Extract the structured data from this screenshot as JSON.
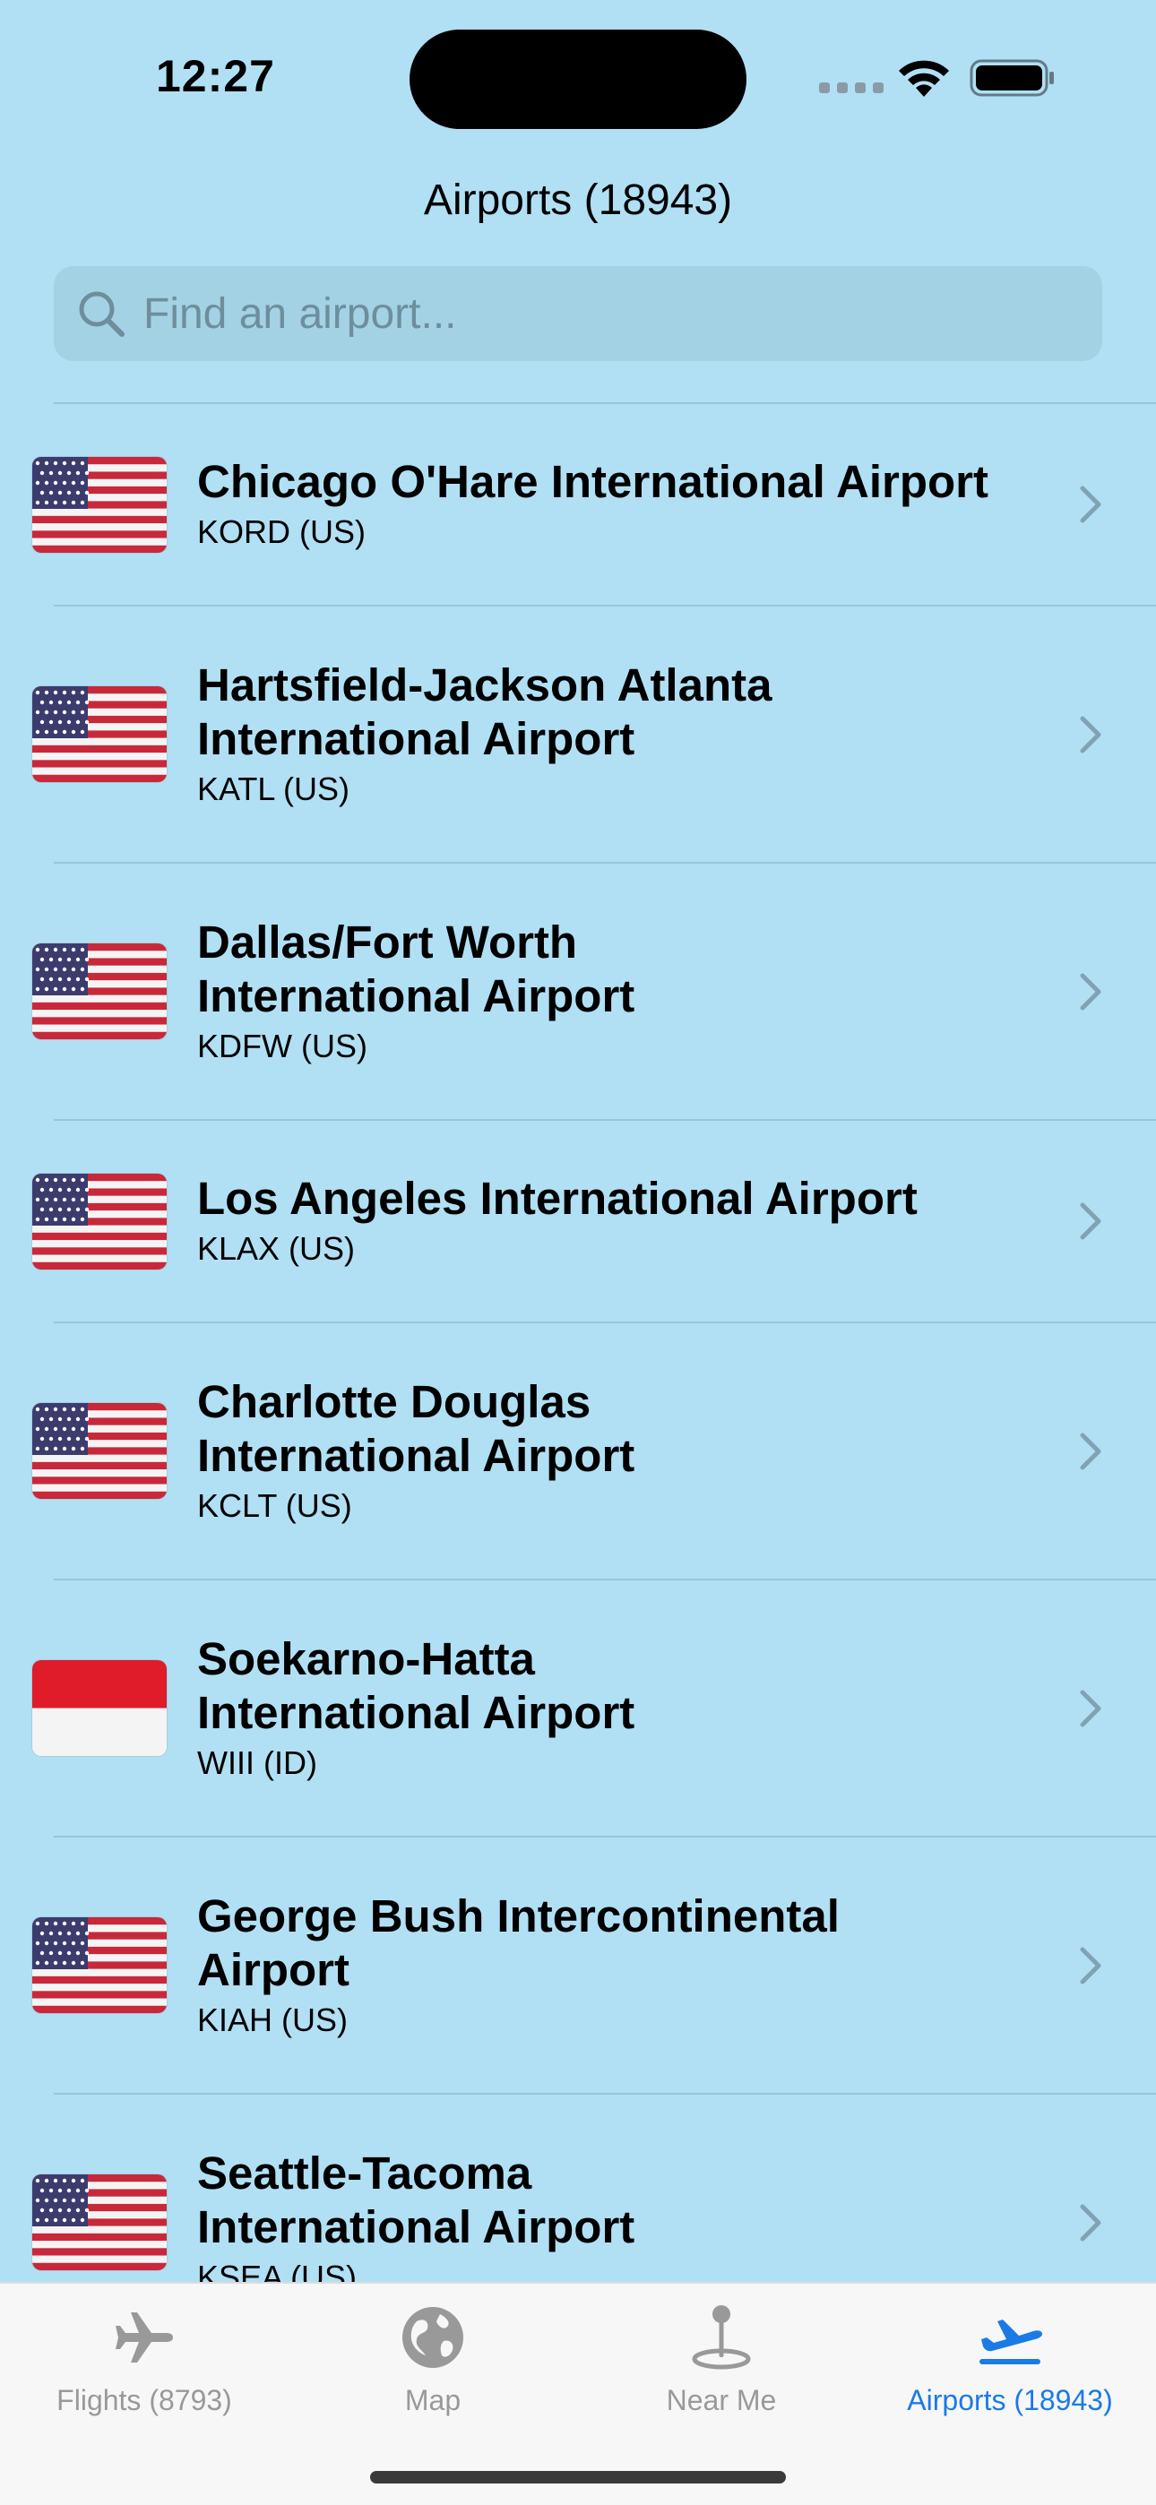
{
  "status_bar": {
    "time": "12:27"
  },
  "header": {
    "title": "Airports (18943)"
  },
  "search": {
    "placeholder": "Find an airport...",
    "icon": "search-icon"
  },
  "airports": [
    {
      "name": "Chicago O'Hare International Airport",
      "code": "KORD (US)",
      "flag": "US"
    },
    {
      "name": "Hartsfield-Jackson Atlanta International Airport",
      "code": "KATL (US)",
      "flag": "US"
    },
    {
      "name": "Dallas/Fort Worth International Airport",
      "code": "KDFW (US)",
      "flag": "US"
    },
    {
      "name": "Los Angeles International Airport",
      "code": "KLAX (US)",
      "flag": "US"
    },
    {
      "name": "Charlotte Douglas International Airport",
      "code": "KCLT (US)",
      "flag": "US"
    },
    {
      "name": "Soekarno-Hatta International Airport",
      "code": "WIII (ID)",
      "flag": "ID"
    },
    {
      "name": "George Bush Intercontinental Airport",
      "code": "KIAH (US)",
      "flag": "US"
    },
    {
      "name": "Seattle-Tacoma International Airport",
      "code": "KSEA (US)",
      "flag": "US"
    }
  ],
  "tabs": [
    {
      "label": "Flights (8793)",
      "icon": "airplane-icon",
      "active": false
    },
    {
      "label": "Map",
      "icon": "globe-icon",
      "active": false
    },
    {
      "label": "Near Me",
      "icon": "location-pin-icon",
      "active": false
    },
    {
      "label": "Airports (18943)",
      "icon": "departure-icon",
      "active": true
    }
  ],
  "colors": {
    "background": "#b1e0f4",
    "accent": "#1a7be6",
    "tab_inactive": "#999999"
  }
}
